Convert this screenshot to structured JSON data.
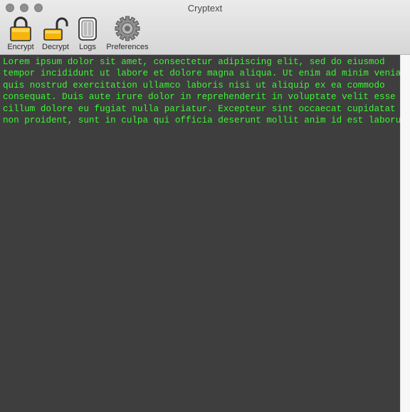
{
  "window": {
    "title": "Cryptext"
  },
  "toolbar": {
    "items": [
      {
        "label": "Encrypt",
        "icon": "lock-closed-icon"
      },
      {
        "label": "Decrypt",
        "icon": "lock-open-icon"
      },
      {
        "label": "Logs",
        "icon": "logs-icon"
      },
      {
        "label": "Preferences",
        "icon": "gear-icon"
      }
    ]
  },
  "editor": {
    "text": "Lorem ipsum dolor sit amet, consectetur adipiscing elit, sed do eiusmod\ntempor incididunt ut labore et dolore magna aliqua. Ut enim ad minim veniam,\nquis nostrud exercitation ullamco laboris nisi ut aliquip ex ea commodo\nconsequat. Duis aute irure dolor in reprehenderit in voluptate velit esse\ncillum dolore eu fugiat nulla pariatur. Excepteur sint occaecat cupidatat\nnon proident, sunt in culpa qui officia deserunt mollit anim id est laborum.",
    "text_color": "#3df536",
    "background_color": "#3e3e3e"
  }
}
